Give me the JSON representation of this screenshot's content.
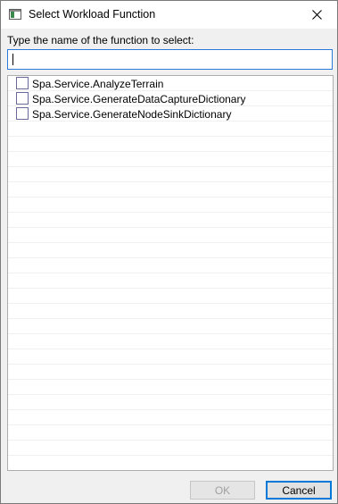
{
  "window": {
    "title": "Select Workload Function"
  },
  "prompt": "Type the name of the function to select:",
  "search": {
    "value": "",
    "placeholder": ""
  },
  "functions": [
    {
      "label": "Spa.Service.AnalyzeTerrain",
      "checked": false
    },
    {
      "label": "Spa.Service.GenerateDataCaptureDictionary",
      "checked": false
    },
    {
      "label": "Spa.Service.GenerateNodeSinkDictionary",
      "checked": false
    }
  ],
  "buttons": {
    "ok_label": "OK",
    "ok_enabled": false,
    "cancel_label": "Cancel"
  },
  "colors": {
    "focus_border": "#2b79d8",
    "default_button_border": "#0078d7",
    "list_row_separator": "#f0f0f0"
  },
  "icons": {
    "app": "window-app-icon",
    "close": "close-icon",
    "checkbox": "checkbox-unchecked-icon"
  }
}
